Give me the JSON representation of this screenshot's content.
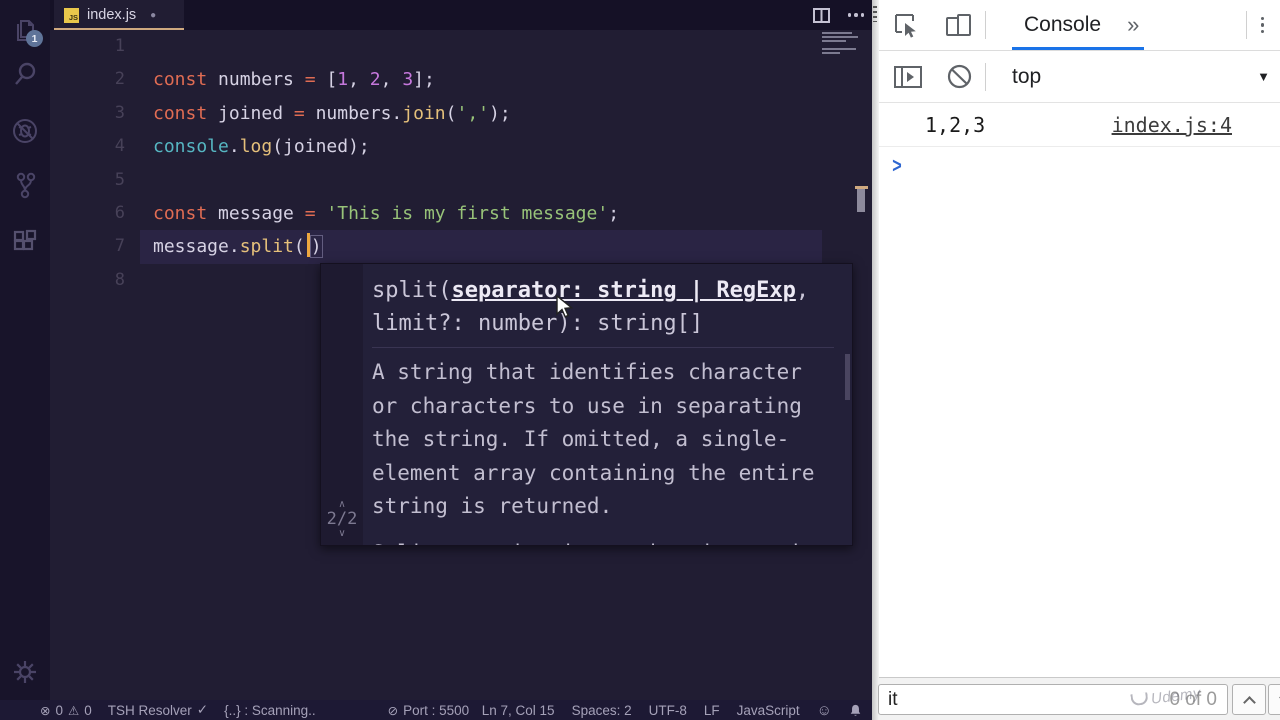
{
  "colors": {
    "editor_bg": "#211d33",
    "activity_bar_bg": "#18142a",
    "tab_underline": "#cfa97f",
    "keyword": "#e06c53",
    "number_literal": "#c678dd",
    "string_literal": "#98c379",
    "function_name": "#e5c07b",
    "console_builtin": "#56b6c2",
    "plain_code": "#d6d2e4",
    "cursor": "#eda73f",
    "devtools_accent": "#1a73e8",
    "js_icon": "#e9c74b",
    "statusbar_bg": "#1d1934",
    "devtools_bg": "#ffffff"
  },
  "activity_bar": {
    "explorer_badge": "1"
  },
  "editor": {
    "tab": {
      "icon_label": "JS",
      "filename": "index.js",
      "dirty_dot": "●"
    },
    "lines": [
      {
        "num": "1",
        "tokens": []
      },
      {
        "num": "2",
        "tokens": [
          [
            "kw",
            "const"
          ],
          [
            "pl",
            " numbers "
          ],
          [
            "op",
            "="
          ],
          [
            "pl",
            " ["
          ],
          [
            "num",
            "1"
          ],
          [
            "pl",
            ", "
          ],
          [
            "num",
            "2"
          ],
          [
            "pl",
            ", "
          ],
          [
            "num",
            "3"
          ],
          [
            "pl",
            "];"
          ]
        ]
      },
      {
        "num": "3",
        "tokens": [
          [
            "kw",
            "const"
          ],
          [
            "pl",
            " joined "
          ],
          [
            "op",
            "="
          ],
          [
            "pl",
            " numbers."
          ],
          [
            "fn",
            "join"
          ],
          [
            "pl",
            "("
          ],
          [
            "str",
            "','"
          ],
          [
            "pl",
            ");"
          ]
        ]
      },
      {
        "num": "4",
        "tokens": [
          [
            "cls",
            "console"
          ],
          [
            "pl",
            "."
          ],
          [
            "fn",
            "log"
          ],
          [
            "pl",
            "(joined);"
          ]
        ]
      },
      {
        "num": "5",
        "tokens": []
      },
      {
        "num": "6",
        "tokens": [
          [
            "kw",
            "const"
          ],
          [
            "pl",
            " message "
          ],
          [
            "op",
            "="
          ],
          [
            "pl",
            " "
          ],
          [
            "str",
            "'This is my first message'"
          ],
          [
            "pl",
            ";"
          ]
        ]
      },
      {
        "num": "7",
        "current": true,
        "tokens": [
          [
            "pl",
            "message."
          ],
          [
            "fn",
            "split"
          ],
          [
            "pl",
            "("
          ],
          [
            "cursor",
            ""
          ],
          [
            "match",
            ")"
          ]
        ]
      },
      {
        "num": "8",
        "tokens": []
      }
    ]
  },
  "hint": {
    "pager_up": "∧",
    "pager": "2/2",
    "pager_down": "∨",
    "signature_pre": "split(",
    "signature_active": "separator: string | RegExp",
    "signature_post": ", limit?: number): string[]",
    "doc_param": "A string that identifies character or characters to use in separating the string. If omitted, a single-element array containing the entire string is returned.",
    "doc_summary": "Split a string into substrings using the specified separator and return them as an"
  },
  "statusbar": {
    "error_icon": "⊗",
    "errors": "0",
    "warning_icon": "⚠",
    "warnings": "0",
    "resolver": "TSH Resolver",
    "resolver_check": "✓",
    "scanning": "{..} : Scanning..",
    "port_icon": "⊘",
    "port": "Port : 5500",
    "cursor_pos": "Ln 7, Col 15",
    "indent": "Spaces: 2",
    "encoding": "UTF-8",
    "eol": "LF",
    "language": "JavaScript",
    "feedback_icon": "☺"
  },
  "devtools": {
    "tab_console": "Console",
    "more_tabs": "»",
    "context": "top",
    "context_caret": "▼",
    "log_value": "1,2,3",
    "log_source": "index.js:4",
    "prompt": ">",
    "find_query": "it",
    "find_count": "0 of 0",
    "watermark": "Udemy"
  },
  "icons": {
    "explorer-icon": "svg-files",
    "search-icon": "svg-magnifier",
    "debug-icon": "svg-bug-slash",
    "source-control-icon": "svg-branch",
    "extensions-icon": "svg-squares",
    "settings-gear-icon": "svg-gear",
    "split-editor-icon": "svg-split",
    "more-actions-icon": "css-dots-horizontal",
    "inspect-icon": "svg-cursor-box",
    "device-toolbar-icon": "svg-devices",
    "console-sidebar-icon": "svg-panel-play",
    "clear-console-icon": "svg-circle-slash",
    "devtools-menu-icon": "css-dots-vertical",
    "bell-icon": "svg-bell",
    "find-prev-icon": "css-chevron-up",
    "find-next-icon": "css-chevron-down",
    "prompt-icon": "blue-chevron",
    "dirty-dot-icon": "●"
  }
}
